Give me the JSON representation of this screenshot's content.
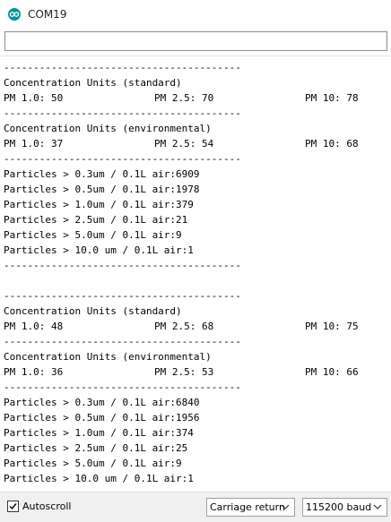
{
  "window": {
    "title": "COM19"
  },
  "send": {
    "value": ""
  },
  "output": {
    "lines": [
      [
        "----------------------------------------"
      ],
      [
        "Concentration Units (standard)"
      ],
      [
        "PM 1.0: 50",
        "PM 2.5: 70",
        "PM 10: 78"
      ],
      [
        "----------------------------------------"
      ],
      [
        "Concentration Units (environmental)"
      ],
      [
        "PM 1.0: 37",
        "PM 2.5: 54",
        "PM 10: 68"
      ],
      [
        "----------------------------------------"
      ],
      [
        "Particles > 0.3um / 0.1L air:6909"
      ],
      [
        "Particles > 0.5um / 0.1L air:1978"
      ],
      [
        "Particles > 1.0um / 0.1L air:379"
      ],
      [
        "Particles > 2.5um / 0.1L air:21"
      ],
      [
        "Particles > 5.0um / 0.1L air:9"
      ],
      [
        "Particles > 10.0 um / 0.1L air:1"
      ],
      [
        "----------------------------------------"
      ],
      [
        ""
      ],
      [
        "----------------------------------------"
      ],
      [
        "Concentration Units (standard)"
      ],
      [
        "PM 1.0: 48",
        "PM 2.5: 68",
        "PM 10: 75"
      ],
      [
        "----------------------------------------"
      ],
      [
        "Concentration Units (environmental)"
      ],
      [
        "PM 1.0: 36",
        "PM 2.5: 53",
        "PM 10: 66"
      ],
      [
        "----------------------------------------"
      ],
      [
        "Particles > 0.3um / 0.1L air:6840"
      ],
      [
        "Particles > 0.5um / 0.1L air:1956"
      ],
      [
        "Particles > 1.0um / 0.1L air:374"
      ],
      [
        "Particles > 2.5um / 0.1L air:25"
      ],
      [
        "Particles > 5.0um / 0.1L air:9"
      ],
      [
        "Particles > 10.0 um / 0.1L air:1"
      ]
    ]
  },
  "footer": {
    "autoscroll_label": "Autoscroll",
    "autoscroll_checked": true,
    "line_ending": "Carriage return",
    "baud": "115200 baud"
  },
  "icons": {
    "app": "arduino-icon",
    "chevron": "chevron-down-icon",
    "check": "check-icon"
  },
  "colors": {
    "app_icon": "#00979c"
  }
}
